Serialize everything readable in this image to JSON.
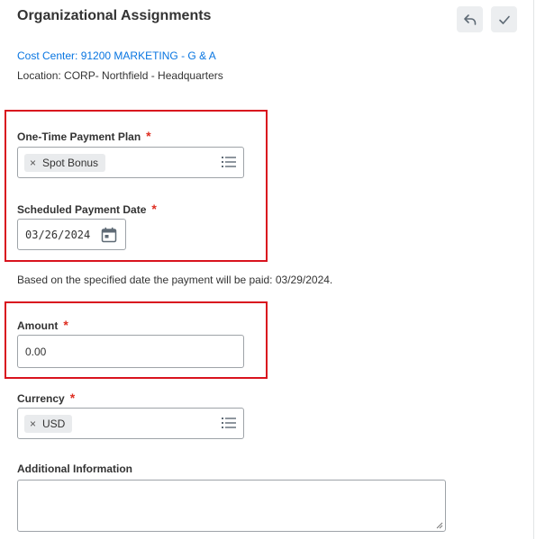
{
  "header": {
    "title": "Organizational Assignments",
    "cancel_icon": "undo-arrow-icon",
    "submit_icon": "checkmark-icon"
  },
  "cost_center": {
    "link_text": "Cost Center: 91200 MARKETING - G & A"
  },
  "location": {
    "text": "Location: CORP- Northfield - Headquarters"
  },
  "payment_plan": {
    "label": "One-Time Payment Plan",
    "required_mark": "*",
    "selected": "Spot Bonus",
    "remove_glyph": "×"
  },
  "payment_date": {
    "label": "Scheduled Payment Date",
    "required_mark": "*",
    "value": "03/26/2024"
  },
  "payment_note": {
    "text": "Based on the specified date the payment will be paid: 03/29/2024."
  },
  "amount": {
    "label": "Amount",
    "required_mark": "*",
    "value": "0.00"
  },
  "currency": {
    "label": "Currency",
    "required_mark": "*",
    "selected": "USD",
    "remove_glyph": "×"
  },
  "additional_info": {
    "label": "Additional Information",
    "value": ""
  },
  "colors": {
    "link": "#0875e1",
    "required": "#de2e21",
    "highlight": "#d9131e"
  }
}
